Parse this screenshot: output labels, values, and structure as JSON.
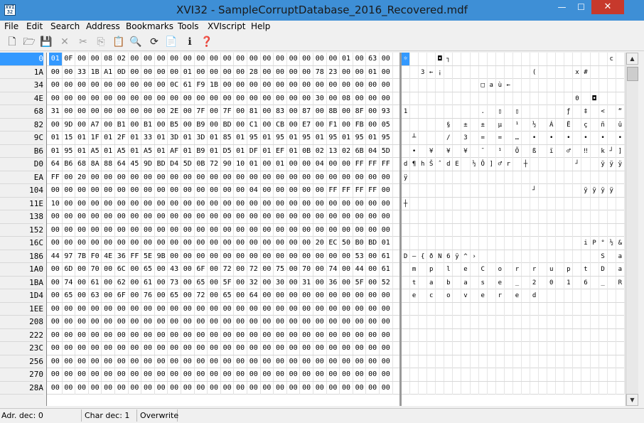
{
  "window": {
    "title": "XVI32 - SampleCorruptDatabase_2016_Recovered.mdf",
    "icon_text": "XVI 32",
    "min": "—",
    "max": "☐",
    "close": "✕"
  },
  "menu": [
    "File",
    "Edit",
    "Search",
    "Address",
    "Bookmarks",
    "Tools",
    "XVIscript",
    "Help"
  ],
  "toolbar": [
    {
      "name": "new-file-icon",
      "glyph": "🗋",
      "enabled": true
    },
    {
      "name": "open-folder-icon",
      "glyph": "🗁",
      "enabled": true
    },
    {
      "name": "save-icon",
      "glyph": "💾",
      "enabled": true
    },
    {
      "name": "delete-icon",
      "glyph": "✕",
      "enabled": false
    },
    {
      "name": "cut-icon",
      "glyph": "✂",
      "enabled": false
    },
    {
      "name": "copy-icon",
      "glyph": "⎘",
      "enabled": false
    },
    {
      "name": "paste-icon",
      "glyph": "📋",
      "enabled": true
    },
    {
      "name": "find-icon",
      "glyph": "🔍",
      "enabled": true
    },
    {
      "name": "replace-icon",
      "glyph": "⟳",
      "enabled": true
    },
    {
      "name": "clipboard-icon",
      "glyph": "📄",
      "enabled": true
    },
    {
      "name": "info-icon",
      "glyph": "ℹ",
      "enabled": true
    },
    {
      "name": "help-icon",
      "glyph": "❓",
      "enabled": true
    }
  ],
  "addresses": [
    "0",
    "1A",
    "34",
    "4E",
    "68",
    "82",
    "9C",
    "B6",
    "D0",
    "EA",
    "104",
    "11E",
    "138",
    "152",
    "16C",
    "186",
    "1A0",
    "1BA",
    "1D4",
    "1EE",
    "208",
    "222",
    "23C",
    "256",
    "270",
    "28A"
  ],
  "hex_rows": [
    [
      "01",
      "0F",
      "00",
      "00",
      "08",
      "02",
      "00",
      "00",
      "00",
      "00",
      "00",
      "00",
      "00",
      "00",
      "00",
      "00",
      "00",
      "00",
      "00",
      "00",
      "00",
      "00",
      "01",
      "00",
      "63",
      "00"
    ],
    [
      "00",
      "00",
      "33",
      "1B",
      "A1",
      "0D",
      "00",
      "00",
      "00",
      "00",
      "01",
      "00",
      "00",
      "00",
      "00",
      "28",
      "00",
      "00",
      "00",
      "00",
      "78",
      "23",
      "00",
      "00",
      "01",
      "00"
    ],
    [
      "00",
      "00",
      "00",
      "00",
      "00",
      "00",
      "00",
      "00",
      "00",
      "0C",
      "61",
      "F9",
      "1B",
      "00",
      "00",
      "00",
      "00",
      "00",
      "00",
      "00",
      "00",
      "00",
      "00",
      "00",
      "00",
      "00"
    ],
    [
      "00",
      "00",
      "00",
      "00",
      "00",
      "00",
      "00",
      "00",
      "00",
      "00",
      "00",
      "00",
      "00",
      "00",
      "00",
      "00",
      "00",
      "00",
      "00",
      "00",
      "30",
      "00",
      "08",
      "00",
      "00",
      "00"
    ],
    [
      "31",
      "00",
      "00",
      "00",
      "00",
      "00",
      "00",
      "00",
      "00",
      "2E",
      "00",
      "7F",
      "00",
      "7F",
      "00",
      "81",
      "00",
      "83",
      "00",
      "87",
      "00",
      "8B",
      "00",
      "8F",
      "00",
      "93"
    ],
    [
      "00",
      "9D",
      "00",
      "A7",
      "00",
      "B1",
      "00",
      "B1",
      "00",
      "B5",
      "00",
      "B9",
      "00",
      "BD",
      "00",
      "C1",
      "00",
      "CB",
      "00",
      "E7",
      "00",
      "F1",
      "00",
      "FB",
      "00",
      "05"
    ],
    [
      "01",
      "15",
      "01",
      "1F",
      "01",
      "2F",
      "01",
      "33",
      "01",
      "3D",
      "01",
      "3D",
      "01",
      "85",
      "01",
      "95",
      "01",
      "95",
      "01",
      "95",
      "01",
      "95",
      "01",
      "95",
      "01",
      "95"
    ],
    [
      "01",
      "95",
      "01",
      "A5",
      "01",
      "A5",
      "01",
      "A5",
      "01",
      "AF",
      "01",
      "B9",
      "01",
      "D5",
      "01",
      "DF",
      "01",
      "EF",
      "01",
      "0B",
      "02",
      "13",
      "02",
      "6B",
      "04",
      "5D"
    ],
    [
      "64",
      "B6",
      "68",
      "8A",
      "88",
      "64",
      "45",
      "9D",
      "BD",
      "D4",
      "5D",
      "0B",
      "72",
      "90",
      "10",
      "01",
      "00",
      "01",
      "00",
      "00",
      "04",
      "00",
      "00",
      "FF",
      "FF",
      "FF"
    ],
    [
      "FF",
      "00",
      "20",
      "00",
      "00",
      "00",
      "00",
      "00",
      "00",
      "00",
      "00",
      "00",
      "00",
      "00",
      "00",
      "00",
      "00",
      "00",
      "00",
      "00",
      "00",
      "00",
      "00",
      "00",
      "00",
      "00"
    ],
    [
      "00",
      "00",
      "00",
      "00",
      "00",
      "00",
      "00",
      "00",
      "00",
      "00",
      "00",
      "00",
      "00",
      "00",
      "00",
      "04",
      "00",
      "00",
      "00",
      "00",
      "00",
      "FF",
      "FF",
      "FF",
      "FF",
      "00"
    ],
    [
      "10",
      "00",
      "00",
      "00",
      "00",
      "00",
      "00",
      "00",
      "00",
      "00",
      "00",
      "00",
      "00",
      "00",
      "00",
      "00",
      "00",
      "00",
      "00",
      "00",
      "00",
      "00",
      "00",
      "00",
      "00",
      "00"
    ],
    [
      "00",
      "00",
      "00",
      "00",
      "00",
      "00",
      "00",
      "00",
      "00",
      "00",
      "00",
      "00",
      "00",
      "00",
      "00",
      "00",
      "00",
      "00",
      "00",
      "00",
      "00",
      "00",
      "00",
      "00",
      "00",
      "00"
    ],
    [
      "00",
      "00",
      "00",
      "00",
      "00",
      "00",
      "00",
      "00",
      "00",
      "00",
      "00",
      "00",
      "00",
      "00",
      "00",
      "00",
      "00",
      "00",
      "00",
      "00",
      "00",
      "00",
      "00",
      "00",
      "00",
      "00"
    ],
    [
      "00",
      "00",
      "00",
      "00",
      "00",
      "00",
      "00",
      "00",
      "00",
      "00",
      "00",
      "00",
      "00",
      "00",
      "00",
      "00",
      "00",
      "00",
      "00",
      "00",
      "20",
      "EC",
      "50",
      "B0",
      "BD",
      "01",
      "26"
    ],
    [
      "44",
      "97",
      "7B",
      "F0",
      "4E",
      "36",
      "FF",
      "5E",
      "9B",
      "00",
      "00",
      "00",
      "00",
      "00",
      "00",
      "00",
      "00",
      "00",
      "00",
      "00",
      "00",
      "00",
      "00",
      "53",
      "00",
      "61"
    ],
    [
      "00",
      "6D",
      "00",
      "70",
      "00",
      "6C",
      "00",
      "65",
      "00",
      "43",
      "00",
      "6F",
      "00",
      "72",
      "00",
      "72",
      "00",
      "75",
      "00",
      "70",
      "00",
      "74",
      "00",
      "44",
      "00",
      "61"
    ],
    [
      "00",
      "74",
      "00",
      "61",
      "00",
      "62",
      "00",
      "61",
      "00",
      "73",
      "00",
      "65",
      "00",
      "5F",
      "00",
      "32",
      "00",
      "30",
      "00",
      "31",
      "00",
      "36",
      "00",
      "5F",
      "00",
      "52"
    ],
    [
      "00",
      "65",
      "00",
      "63",
      "00",
      "6F",
      "00",
      "76",
      "00",
      "65",
      "00",
      "72",
      "00",
      "65",
      "00",
      "64",
      "00",
      "00",
      "00",
      "00",
      "00",
      "00",
      "00",
      "00",
      "00",
      "00"
    ],
    [
      "00",
      "00",
      "00",
      "00",
      "00",
      "00",
      "00",
      "00",
      "00",
      "00",
      "00",
      "00",
      "00",
      "00",
      "00",
      "00",
      "00",
      "00",
      "00",
      "00",
      "00",
      "00",
      "00",
      "00",
      "00",
      "00"
    ],
    [
      "00",
      "00",
      "00",
      "00",
      "00",
      "00",
      "00",
      "00",
      "00",
      "00",
      "00",
      "00",
      "00",
      "00",
      "00",
      "00",
      "00",
      "00",
      "00",
      "00",
      "00",
      "00",
      "00",
      "00",
      "00",
      "00"
    ],
    [
      "00",
      "00",
      "00",
      "00",
      "00",
      "00",
      "00",
      "00",
      "00",
      "00",
      "00",
      "00",
      "00",
      "00",
      "00",
      "00",
      "00",
      "00",
      "00",
      "00",
      "00",
      "00",
      "00",
      "00",
      "00",
      "00"
    ],
    [
      "00",
      "00",
      "00",
      "00",
      "00",
      "00",
      "00",
      "00",
      "00",
      "00",
      "00",
      "00",
      "00",
      "00",
      "00",
      "00",
      "00",
      "00",
      "00",
      "00",
      "00",
      "00",
      "00",
      "00",
      "00",
      "00"
    ],
    [
      "00",
      "00",
      "00",
      "00",
      "00",
      "00",
      "00",
      "00",
      "00",
      "00",
      "00",
      "00",
      "00",
      "00",
      "00",
      "00",
      "00",
      "00",
      "00",
      "00",
      "00",
      "00",
      "00",
      "00",
      "00",
      "00"
    ],
    [
      "00",
      "00",
      "00",
      "00",
      "00",
      "00",
      "00",
      "00",
      "00",
      "00",
      "00",
      "00",
      "00",
      "00",
      "00",
      "00",
      "00",
      "00",
      "00",
      "00",
      "00",
      "00",
      "00",
      "00",
      "00",
      "00"
    ],
    [
      "00",
      "00",
      "00",
      "00",
      "00",
      "00",
      "00",
      "00",
      "00",
      "00",
      "00",
      "00",
      "00",
      "00",
      "00",
      "00",
      "00",
      "00",
      "00",
      "00",
      "00",
      "00",
      "00",
      "00",
      "00",
      "00"
    ]
  ],
  "char_rows": [
    [
      "☼",
      "",
      "",
      "",
      "◘",
      "┐",
      "",
      "",
      "",
      "",
      "",
      "",
      "",
      "",
      "",
      "",
      "",
      "",
      "",
      "",
      "",
      "",
      "",
      "",
      "c",
      ""
    ],
    [
      "",
      "",
      "3",
      "←",
      "¡",
      "",
      "",
      "",
      "",
      "",
      "",
      "",
      "",
      "",
      "",
      "(",
      "",
      "",
      "",
      "",
      "x",
      "#",
      "",
      "",
      "",
      ""
    ],
    [
      "",
      "",
      "",
      "",
      "",
      "",
      "",
      "",
      "",
      "□",
      "a",
      "ù",
      "←",
      "",
      "",
      "",
      "",
      "",
      "",
      "",
      "",
      "",
      "",
      "",
      "",
      ""
    ],
    [
      "",
      "",
      "",
      "",
      "",
      "",
      "",
      "",
      "",
      "",
      "",
      "",
      "",
      "",
      "",
      "",
      "",
      "",
      "",
      "",
      "0",
      "",
      "◘",
      "",
      "",
      ""
    ],
    [
      "1",
      "",
      "",
      "",
      "",
      "",
      "",
      "",
      "",
      ".",
      "",
      "▯",
      "",
      "▯",
      "",
      "",
      "",
      "",
      "",
      "ƒ",
      "",
      "‡",
      "",
      "<",
      "",
      "“"
    ],
    [
      "",
      "",
      "",
      "",
      "",
      "§",
      "",
      "±",
      "",
      "±",
      "",
      "µ",
      "",
      "¹",
      "",
      "½",
      "",
      "Á",
      "",
      "Ë",
      "",
      "ç",
      "",
      "ñ",
      "",
      "û"
    ],
    [
      "",
      "┴",
      "",
      "",
      "",
      "/",
      "",
      "3",
      "",
      "=",
      "",
      "=",
      "",
      "…",
      "",
      "•",
      "",
      "•",
      "",
      "•",
      "",
      "•",
      "",
      "•",
      "",
      "•"
    ],
    [
      "",
      "•",
      "",
      "¥",
      "",
      "¥",
      "",
      "¥",
      "",
      "¯",
      "",
      "¹",
      "",
      "Õ",
      "",
      "ß",
      "",
      "ï",
      "",
      "♂",
      "",
      "‼",
      "",
      "k",
      "┘",
      "]"
    ],
    [
      "d",
      "¶",
      "h",
      "Š",
      "ˆ",
      "d",
      "E",
      "",
      "½",
      "Ô",
      "]",
      "♂",
      "r",
      "",
      "┼",
      "",
      "",
      "",
      "",
      "",
      "┘",
      "",
      "",
      "ÿ",
      "ÿ",
      "ÿ"
    ],
    [
      "ÿ",
      "",
      "",
      "",
      "",
      "",
      "",
      "",
      "",
      "",
      "",
      "",
      "",
      "",
      "",
      "",
      "",
      "",
      "",
      "",
      "",
      "",
      "",
      "",
      "",
      ""
    ],
    [
      "",
      "",
      "",
      "",
      "",
      "",
      "",
      "",
      "",
      "",
      "",
      "",
      "",
      "",
      "",
      "┘",
      "",
      "",
      "",
      "",
      "",
      "ÿ",
      "ÿ",
      "ÿ",
      "ÿ",
      ""
    ],
    [
      "┼",
      "",
      "",
      "",
      "",
      "",
      "",
      "",
      "",
      "",
      "",
      "",
      "",
      "",
      "",
      "",
      "",
      "",
      "",
      "",
      "",
      "",
      "",
      "",
      "",
      ""
    ],
    [
      "",
      "",
      "",
      "",
      "",
      "",
      "",
      "",
      "",
      "",
      "",
      "",
      "",
      "",
      "",
      "",
      "",
      "",
      "",
      "",
      "",
      "",
      "",
      "",
      "",
      ""
    ],
    [
      "",
      "",
      "",
      "",
      "",
      "",
      "",
      "",
      "",
      "",
      "",
      "",
      "",
      "",
      "",
      "",
      "",
      "",
      "",
      "",
      "",
      "",
      "",
      "",
      "",
      ""
    ],
    [
      "",
      "",
      "",
      "",
      "",
      "",
      "",
      "",
      "",
      "",
      "",
      "",
      "",
      "",
      "",
      "",
      "",
      "",
      "",
      "",
      "",
      "i",
      "P",
      "°",
      "½",
      "&"
    ],
    [
      "D",
      "—",
      "{",
      "ð",
      "N",
      "6",
      "ÿ",
      "^",
      "›",
      "",
      "",
      "",
      "",
      "",
      "",
      "",
      "",
      "",
      "",
      "",
      "",
      "",
      "",
      "S",
      "",
      "a"
    ],
    [
      "",
      "m",
      "",
      "p",
      "",
      "l",
      "",
      "e",
      "",
      "C",
      "",
      "o",
      "",
      "r",
      "",
      "r",
      "",
      "u",
      "",
      "p",
      "",
      "t",
      "",
      "D",
      "",
      "a"
    ],
    [
      "",
      "t",
      "",
      "a",
      "",
      "b",
      "",
      "a",
      "",
      "s",
      "",
      "e",
      "",
      "_",
      "",
      "2",
      "",
      "0",
      "",
      "1",
      "",
      "6",
      "",
      "_",
      "",
      "R"
    ],
    [
      "",
      "e",
      "",
      "c",
      "",
      "o",
      "",
      "v",
      "",
      "e",
      "",
      "r",
      "",
      "e",
      "",
      "d",
      "",
      "",
      "",
      "",
      "",
      "",
      "",
      "",
      "",
      ""
    ],
    [
      "",
      "",
      "",
      "",
      "",
      "",
      "",
      "",
      "",
      "",
      "",
      "",
      "",
      "",
      "",
      "",
      "",
      "",
      "",
      "",
      "",
      "",
      "",
      "",
      "",
      ""
    ],
    [
      "",
      "",
      "",
      "",
      "",
      "",
      "",
      "",
      "",
      "",
      "",
      "",
      "",
      "",
      "",
      "",
      "",
      "",
      "",
      "",
      "",
      "",
      "",
      "",
      "",
      ""
    ],
    [
      "",
      "",
      "",
      "",
      "",
      "",
      "",
      "",
      "",
      "",
      "",
      "",
      "",
      "",
      "",
      "",
      "",
      "",
      "",
      "",
      "",
      "",
      "",
      "",
      "",
      ""
    ],
    [
      "",
      "",
      "",
      "",
      "",
      "",
      "",
      "",
      "",
      "",
      "",
      "",
      "",
      "",
      "",
      "",
      "",
      "",
      "",
      "",
      "",
      "",
      "",
      "",
      "",
      ""
    ],
    [
      "",
      "",
      "",
      "",
      "",
      "",
      "",
      "",
      "",
      "",
      "",
      "",
      "",
      "",
      "",
      "",
      "",
      "",
      "",
      "",
      "",
      "",
      "",
      "",
      "",
      ""
    ],
    [
      "",
      "",
      "",
      "",
      "",
      "",
      "",
      "",
      "",
      "",
      "",
      "",
      "",
      "",
      "",
      "",
      "",
      "",
      "",
      "",
      "",
      "",
      "",
      "",
      "",
      ""
    ],
    [
      "",
      "",
      "",
      "",
      "",
      "",
      "",
      "",
      "",
      "",
      "",
      "",
      "",
      "",
      "",
      "",
      "",
      "",
      "",
      "",
      "",
      "",
      "",
      "",
      "",
      ""
    ]
  ],
  "scrollbar": {
    "up": "▲",
    "down": "▼"
  },
  "status": {
    "adr": "Adr. dec: 0",
    "char": "Char dec: 1",
    "mode": "Overwrite"
  },
  "colors": {
    "title_bar": "#3e8fd6",
    "selection": "#3399ff",
    "close": "#c7392c"
  }
}
